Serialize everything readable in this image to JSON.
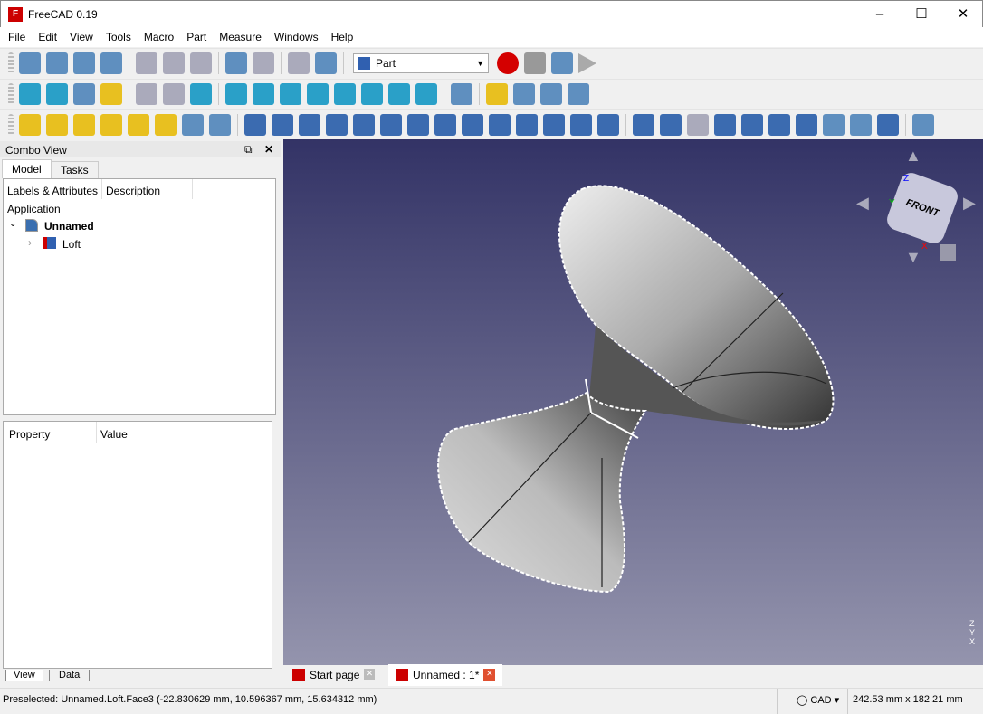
{
  "window": {
    "title": "FreeCAD 0.19",
    "logo": "FC"
  },
  "menu": [
    "File",
    "Edit",
    "View",
    "Tools",
    "Macro",
    "Part",
    "Measure",
    "Windows",
    "Help"
  ],
  "toolbar": {
    "workbench": "Part",
    "row1": [
      "new-icon",
      "open-icon",
      "save-icon",
      "save-as-icon",
      "|",
      "cut-icon",
      "copy-icon",
      "paste-icon",
      "|",
      "undo-icon",
      "redo-icon",
      "|",
      "refresh-icon",
      "whats-this-icon"
    ],
    "row1b": [
      "record-macro-icon",
      "stop-macro-icon",
      "edit-macro-icon",
      "run-macro-icon"
    ],
    "row2": [
      "fit-all-icon",
      "fit-selection-icon",
      "draw-style-icon",
      "bounding-box-icon",
      "|",
      "back-icon",
      "forward-icon",
      "std-views-icon",
      "|",
      "zoom-icon",
      "isometric-icon",
      "front-view-icon",
      "top-view-icon",
      "right-view-icon",
      "rear-view-icon",
      "bottom-view-icon",
      "left-view-icon",
      "|",
      "measure-icon",
      "|",
      "part-icon",
      "group-icon",
      "link-icon",
      "link-actions-icon"
    ],
    "row3": [
      "box-icon",
      "cylinder-icon",
      "sphere-icon",
      "cone-icon",
      "torus-icon",
      "tube-icon",
      "primitives-icon",
      "shape-builder-icon",
      "|",
      "extrude-icon",
      "revolve-icon",
      "mirror-icon",
      "fillet-icon",
      "chamfer-icon",
      "make-face-icon",
      "ruled-surface-icon",
      "loft-icon",
      "sweep-icon",
      "section-icon",
      "cross-sections-icon",
      "offset-icon",
      "thickness-icon",
      "projection-icon",
      "|",
      "compound-icon",
      "boolean-icon",
      "cut-icon",
      "fuse-icon",
      "common-icon",
      "join-icon",
      "split-icon",
      "check-geometry-icon",
      "defeaturing-icon",
      "attachment-icon",
      "|",
      "measure-linear-icon"
    ]
  },
  "colors": {
    "record": "#d40000",
    "accent": "#c00000",
    "viewport_top": "#333366",
    "viewport_bottom": "#9494ad"
  },
  "combo": {
    "title": "Combo View",
    "tabs": [
      "Model",
      "Tasks"
    ],
    "tree_cols": [
      "Labels & Attributes",
      "Description"
    ],
    "tree": {
      "root": "Application",
      "doc": "Unnamed",
      "child": "Loft"
    },
    "prop_cols": [
      "Property",
      "Value"
    ],
    "bottom_tabs": [
      "View",
      "Data"
    ]
  },
  "nav": {
    "face": "FRONT",
    "top": "Z",
    "x": "X",
    "y": "Y"
  },
  "axis": {
    "x": "X",
    "y": "Y",
    "z": "Z"
  },
  "doc_tabs": [
    "Start page",
    "Unnamed : 1*"
  ],
  "status": {
    "text": "Preselected: Unnamed.Loft.Face3 (-22.830629 mm, 10.596367 mm, 15.634312 mm)",
    "nav_style": "CAD",
    "dims": "242.53 mm x 182.21 mm"
  }
}
